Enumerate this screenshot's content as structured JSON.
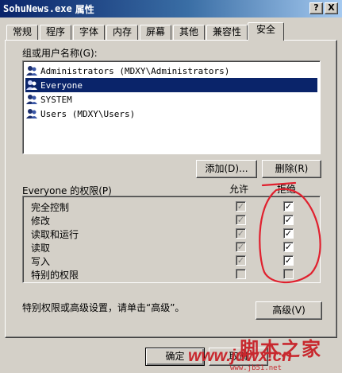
{
  "window": {
    "title_app": "SohuNews.exe",
    "title_props": "属性",
    "help_btn": "?",
    "close_btn": "X"
  },
  "tabs": [
    "常规",
    "程序",
    "字体",
    "内存",
    "屏幕",
    "其他",
    "兼容性",
    "安全"
  ],
  "active_tab": "安全",
  "group_label": "组或用户名称(G):",
  "users": [
    {
      "name": "Administrators (MDXY\\Administrators)",
      "selected": false
    },
    {
      "name": "Everyone",
      "selected": true
    },
    {
      "name": "SYSTEM",
      "selected": false
    },
    {
      "name": "Users (MDXY\\Users)",
      "selected": false
    }
  ],
  "buttons": {
    "add": "添加(D)...",
    "remove": "删除(R)",
    "advanced": "高级(V)",
    "ok": "确定",
    "cancel": "取消"
  },
  "permissions": {
    "header": "Everyone 的权限(P)",
    "allow_header": "允许",
    "deny_header": "拒绝",
    "rows": [
      {
        "name": "完全控制",
        "allow": true,
        "deny": true
      },
      {
        "name": "修改",
        "allow": true,
        "deny": true
      },
      {
        "name": "读取和运行",
        "allow": true,
        "deny": true
      },
      {
        "name": "读取",
        "allow": true,
        "deny": true
      },
      {
        "name": "写入",
        "allow": true,
        "deny": true
      },
      {
        "name": "特别的权限",
        "allow": false,
        "deny": false
      }
    ]
  },
  "advanced_hint": "特别权限或高级设置，请单击“高级”。",
  "watermark": {
    "line1": "脚本之家",
    "line2": "www.jdwx.cn",
    "line3": "www.jb51.net"
  },
  "colors": {
    "annotation": "#e0202e",
    "selection": "#0a246a",
    "face": "#d4d0c8",
    "watermark": "#c8282e"
  }
}
